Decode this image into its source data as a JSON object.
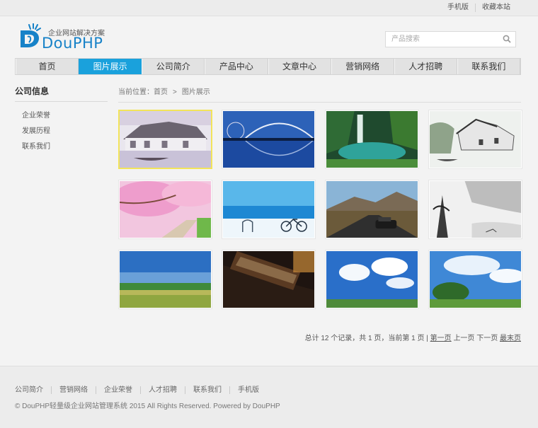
{
  "topbar": {
    "links": [
      "手机版",
      "收藏本站"
    ]
  },
  "logo": {
    "slogan": "企业网站解决方案",
    "brand": "DouPHP"
  },
  "search": {
    "placeholder": "产品搜索"
  },
  "nav": {
    "items": [
      "首页",
      "图片展示",
      "公司简介",
      "产品中心",
      "文章中心",
      "营销网络",
      "人才招聘",
      "联系我们"
    ],
    "active_index": 1
  },
  "sidebar": {
    "title": "公司信息",
    "items": [
      "企业荣誉",
      "发展历程",
      "联系我们"
    ]
  },
  "breadcrumb": {
    "prefix": "当前位置：",
    "home": "首页",
    "separator": ">",
    "current": "图片展示"
  },
  "gallery": {
    "selected_index": 0,
    "images": [
      "watercolor-village-icon",
      "arch-bridge-icon",
      "waterfall-icon",
      "ink-village-icon",
      "cherry-blossom-icon",
      "beach-bicycle-icon",
      "mountain-road-car-icon",
      "ink-landscape-icon",
      "green-field-icon",
      "travel-sign-icon",
      "blue-sky-clouds-icon",
      "trees-sky-icon"
    ]
  },
  "pager": {
    "summary": "总计 12 个记录，共 1 页，当前第 1 页 |",
    "first": "第一页",
    "prev": "上一页",
    "next": "下一页",
    "last": "最末页"
  },
  "footer": {
    "links": [
      "公司简介",
      "营销网络",
      "企业荣誉",
      "人才招聘",
      "联系我们",
      "手机版"
    ],
    "copyright": "© DouPHP轻量级企业网站管理系统 2015 All Rights Reserved. Powered by DouPHP"
  },
  "colors": {
    "accent": "#1aa1dc",
    "brand": "#1782c8",
    "selected_border": "#f2e45a"
  }
}
